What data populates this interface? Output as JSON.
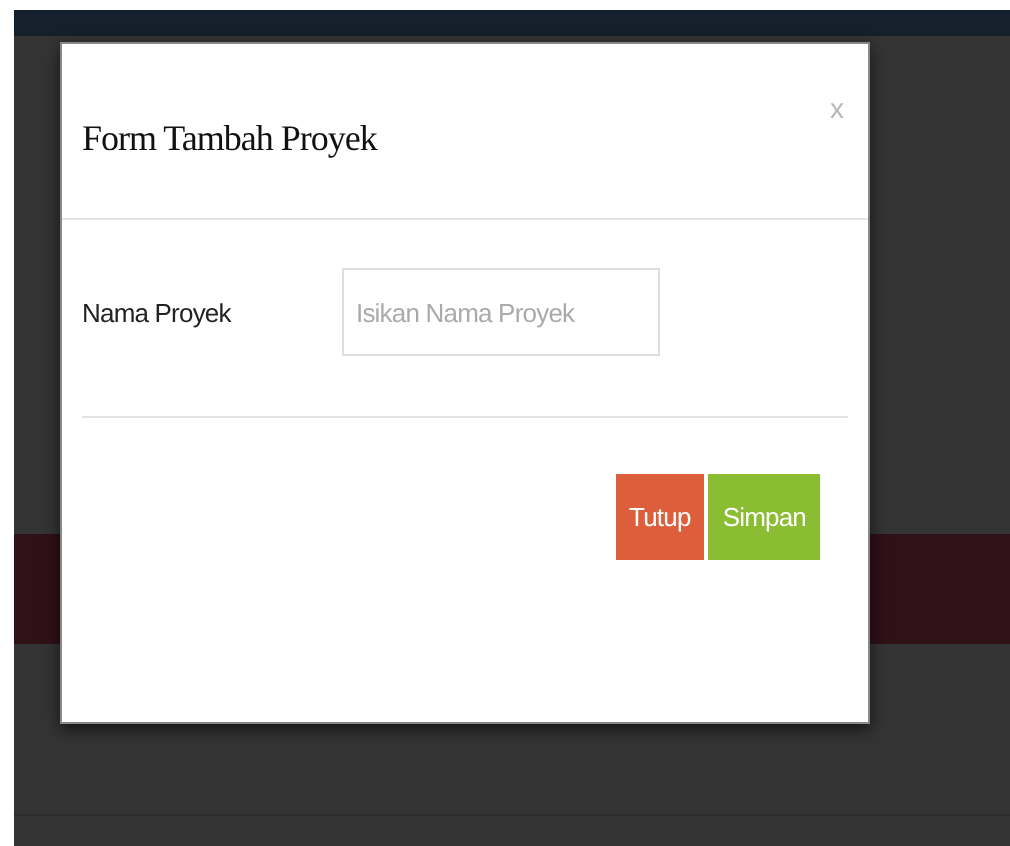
{
  "modal": {
    "title": "Form Tambah Proyek",
    "close": "x",
    "fields": [
      {
        "label": "Nama Proyek",
        "placeholder": "Isikan Nama Proyek"
      }
    ],
    "buttons": [
      {
        "label": "Tutup",
        "kind": "danger"
      },
      {
        "label": "Simpan",
        "kind": "success"
      }
    ]
  }
}
